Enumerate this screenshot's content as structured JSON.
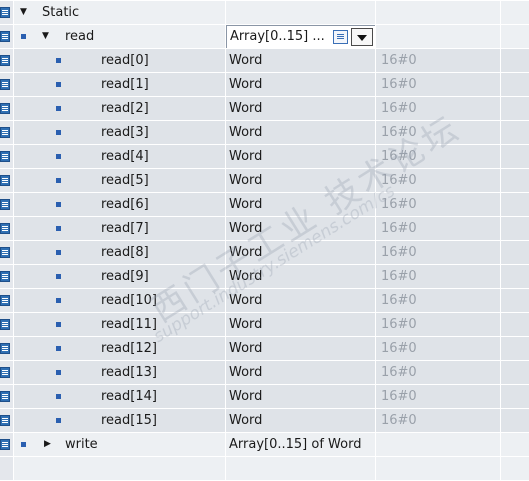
{
  "section": {
    "label": "Static",
    "expander": "▼"
  },
  "read_row": {
    "name": "read",
    "expander": "▼",
    "type_value": "Array[0..15] ...",
    "list_button_icon": "list-icon",
    "dropdown_icon": "chevron-down-icon"
  },
  "elements": [
    {
      "name": "read[0]",
      "type": "Word",
      "default": "16#0"
    },
    {
      "name": "read[1]",
      "type": "Word",
      "default": "16#0"
    },
    {
      "name": "read[2]",
      "type": "Word",
      "default": "16#0"
    },
    {
      "name": "read[3]",
      "type": "Word",
      "default": "16#0"
    },
    {
      "name": "read[4]",
      "type": "Word",
      "default": "16#0"
    },
    {
      "name": "read[5]",
      "type": "Word",
      "default": "16#0"
    },
    {
      "name": "read[6]",
      "type": "Word",
      "default": "16#0"
    },
    {
      "name": "read[7]",
      "type": "Word",
      "default": "16#0"
    },
    {
      "name": "read[8]",
      "type": "Word",
      "default": "16#0"
    },
    {
      "name": "read[9]",
      "type": "Word",
      "default": "16#0"
    },
    {
      "name": "read[10]",
      "type": "Word",
      "default": "16#0"
    },
    {
      "name": "read[11]",
      "type": "Word",
      "default": "16#0"
    },
    {
      "name": "read[12]",
      "type": "Word",
      "default": "16#0"
    },
    {
      "name": "read[13]",
      "type": "Word",
      "default": "16#0"
    },
    {
      "name": "read[14]",
      "type": "Word",
      "default": "16#0"
    },
    {
      "name": "read[15]",
      "type": "Word",
      "default": "16#0"
    }
  ],
  "write_row": {
    "name": "write",
    "expander": "▶",
    "type": "Array[0..15] of Word"
  },
  "watermark": {
    "line1": "西门子工业 技术论坛",
    "line2": "support.industry.siemens.com/cs"
  },
  "colors": {
    "row_light": "#edf0f3",
    "row_mid": "#dfe3e8",
    "default_text": "#9aa1aa",
    "marker_blue": "#2a5fb0"
  }
}
